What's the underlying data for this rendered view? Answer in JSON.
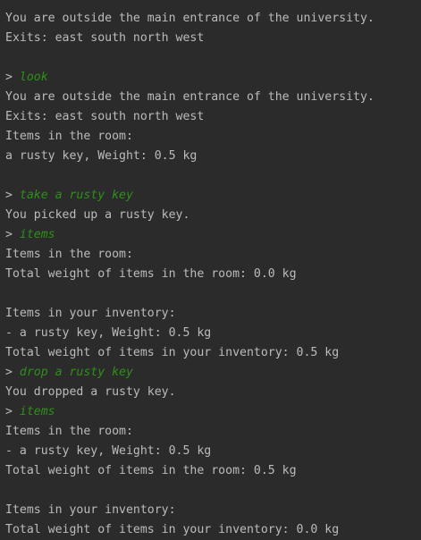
{
  "console": {
    "prompt_symbol": ">",
    "lines": [
      {
        "kind": "out",
        "text": "You are outside the main entrance of the university."
      },
      {
        "kind": "out",
        "text": "Exits: east south north west"
      },
      {
        "kind": "blank",
        "text": ""
      },
      {
        "kind": "cmd",
        "text": "look"
      },
      {
        "kind": "out",
        "text": "You are outside the main entrance of the university."
      },
      {
        "kind": "out",
        "text": "Exits: east south north west"
      },
      {
        "kind": "out",
        "text": "Items in the room:"
      },
      {
        "kind": "out",
        "text": "a rusty key, Weight: 0.5 kg"
      },
      {
        "kind": "blank",
        "text": ""
      },
      {
        "kind": "cmd",
        "text": "take a rusty key"
      },
      {
        "kind": "out",
        "text": "You picked up a rusty key."
      },
      {
        "kind": "cmd",
        "text": "items"
      },
      {
        "kind": "out",
        "text": "Items in the room:"
      },
      {
        "kind": "out",
        "text": "Total weight of items in the room: 0.0 kg"
      },
      {
        "kind": "blank",
        "text": ""
      },
      {
        "kind": "out",
        "text": "Items in your inventory:"
      },
      {
        "kind": "out",
        "text": "- a rusty key, Weight: 0.5 kg"
      },
      {
        "kind": "out",
        "text": "Total weight of items in your inventory: 0.5 kg"
      },
      {
        "kind": "cmd",
        "text": "drop a rusty key"
      },
      {
        "kind": "out",
        "text": "You dropped a rusty key."
      },
      {
        "kind": "cmd",
        "text": "items"
      },
      {
        "kind": "out",
        "text": "Items in the room:"
      },
      {
        "kind": "out",
        "text": "- a rusty key, Weight: 0.5 kg"
      },
      {
        "kind": "out",
        "text": "Total weight of items in the room: 0.5 kg"
      },
      {
        "kind": "blank",
        "text": ""
      },
      {
        "kind": "out",
        "text": "Items in your inventory:"
      },
      {
        "kind": "out",
        "text": "Total weight of items in your inventory: 0.0 kg"
      }
    ]
  },
  "colors": {
    "background": "#2b2b2b",
    "output_text": "#bbbbbb",
    "command_text": "#2f8f1a"
  }
}
